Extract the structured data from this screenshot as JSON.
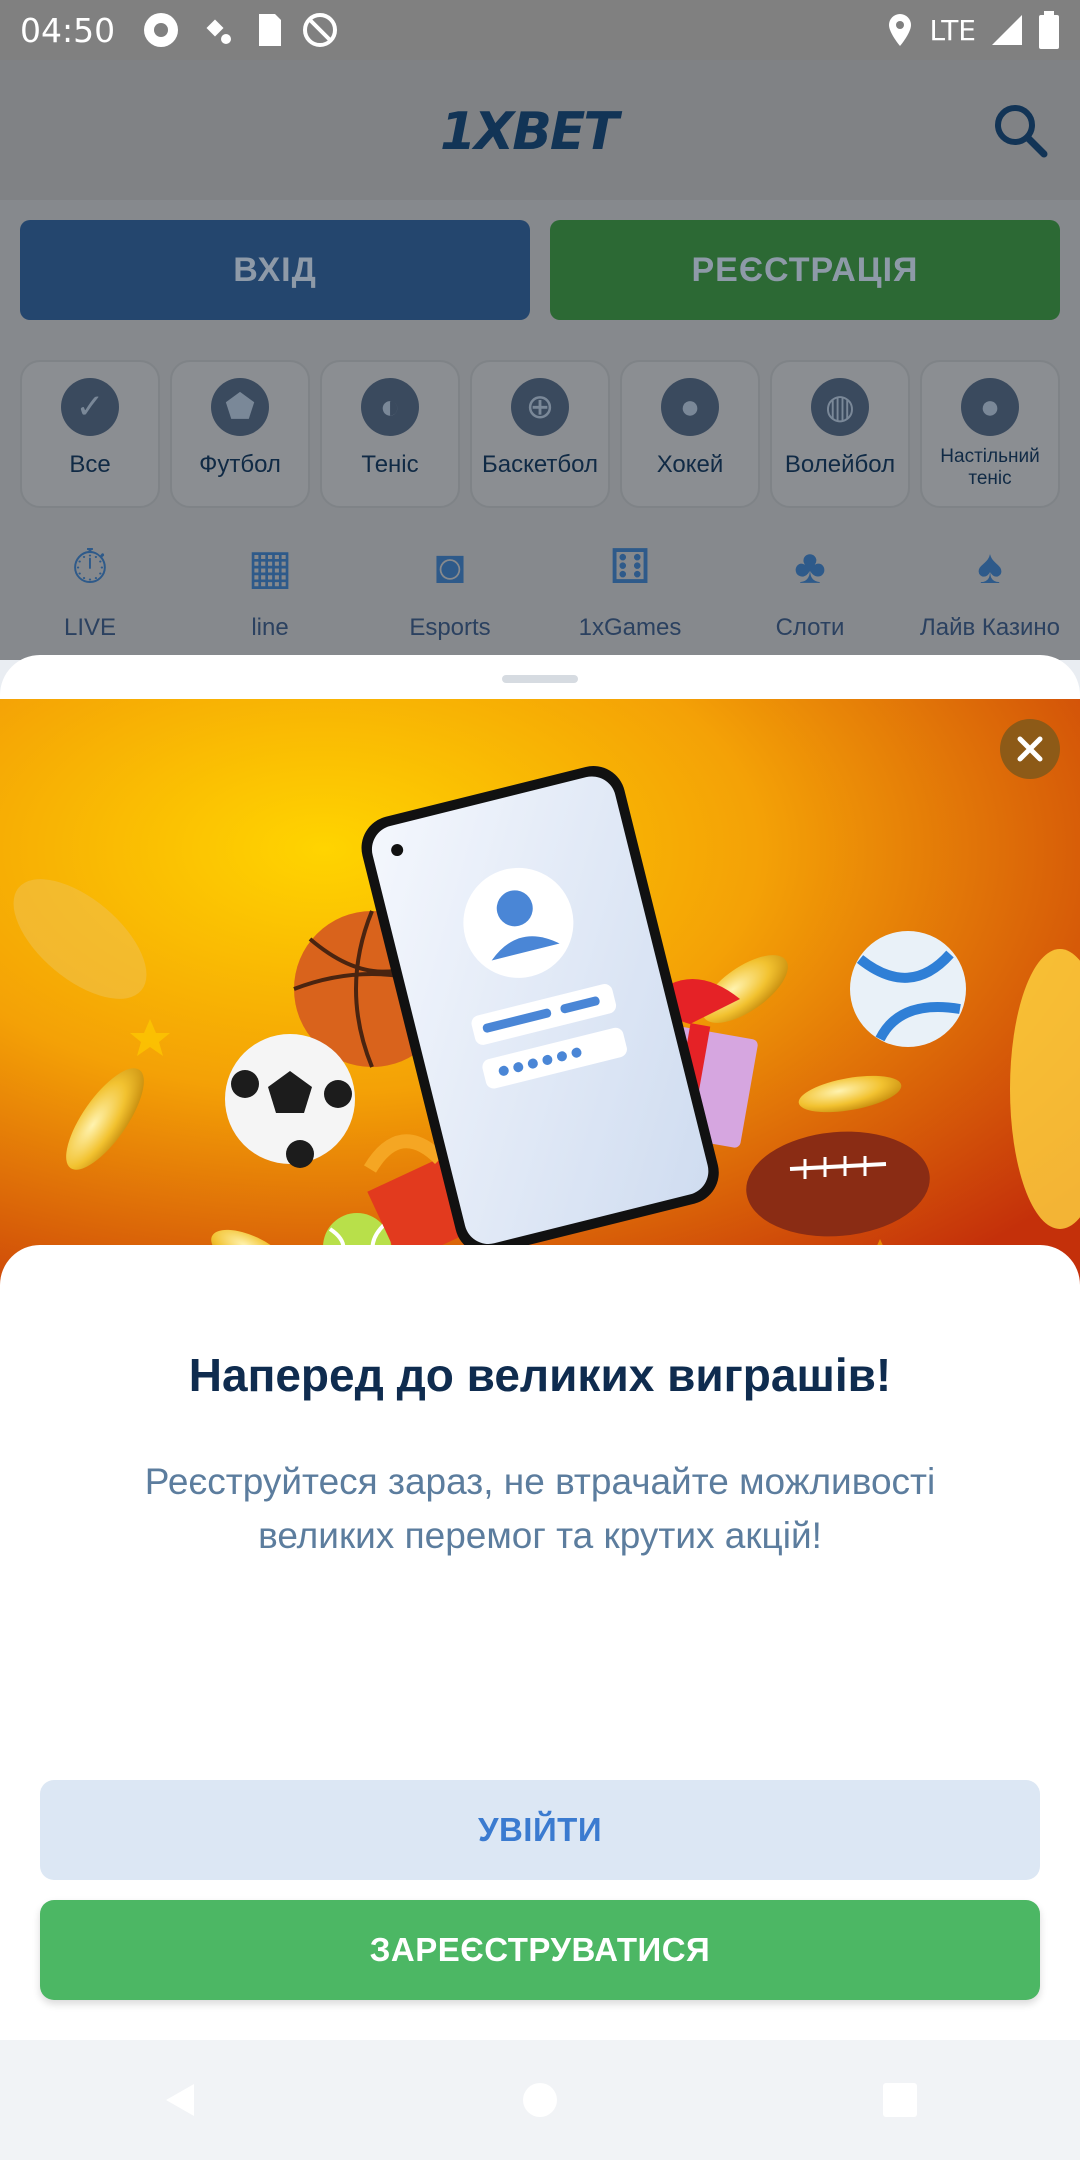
{
  "status_bar": {
    "time": "04:50",
    "network": "LTE"
  },
  "header": {
    "logo_text": "1XBET"
  },
  "auth": {
    "login_label": "ВХІД",
    "register_label": "РЕЄСТРАЦІЯ"
  },
  "sports": [
    {
      "label": "Все",
      "icon": "all-sports-icon"
    },
    {
      "label": "Футбол",
      "icon": "football-icon"
    },
    {
      "label": "Теніс",
      "icon": "tennis-icon"
    },
    {
      "label": "Баскетбол",
      "icon": "basketball-icon"
    },
    {
      "label": "Хокей",
      "icon": "hockey-icon"
    },
    {
      "label": "Волейбол",
      "icon": "volleyball-icon"
    },
    {
      "label": "Настільний теніс",
      "icon": "table-tennis-icon"
    }
  ],
  "categories": [
    {
      "label": "LIVE",
      "icon": "stopwatch-icon"
    },
    {
      "label": "line",
      "icon": "calendar-icon"
    },
    {
      "label": "Esports",
      "icon": "gamepad-icon"
    },
    {
      "label": "1xGames",
      "icon": "dice-icon"
    },
    {
      "label": "Слоти",
      "icon": "cherry-icon"
    },
    {
      "label": "Лайв Казино",
      "icon": "spade-icon"
    }
  ],
  "promo": {
    "title": "Наперед до великих виграшів!",
    "text": "Реєструйтеся зараз, не втрачайте можливості великих перемог та крутих акцій!",
    "enter_label": "УВІЙТИ",
    "signup_label": "ЗАРЕЄСТРУВАТИСЯ"
  },
  "colors": {
    "brand_blue": "#123456",
    "signup_green": "#4cb764",
    "enter_bg": "#dce7f4"
  }
}
